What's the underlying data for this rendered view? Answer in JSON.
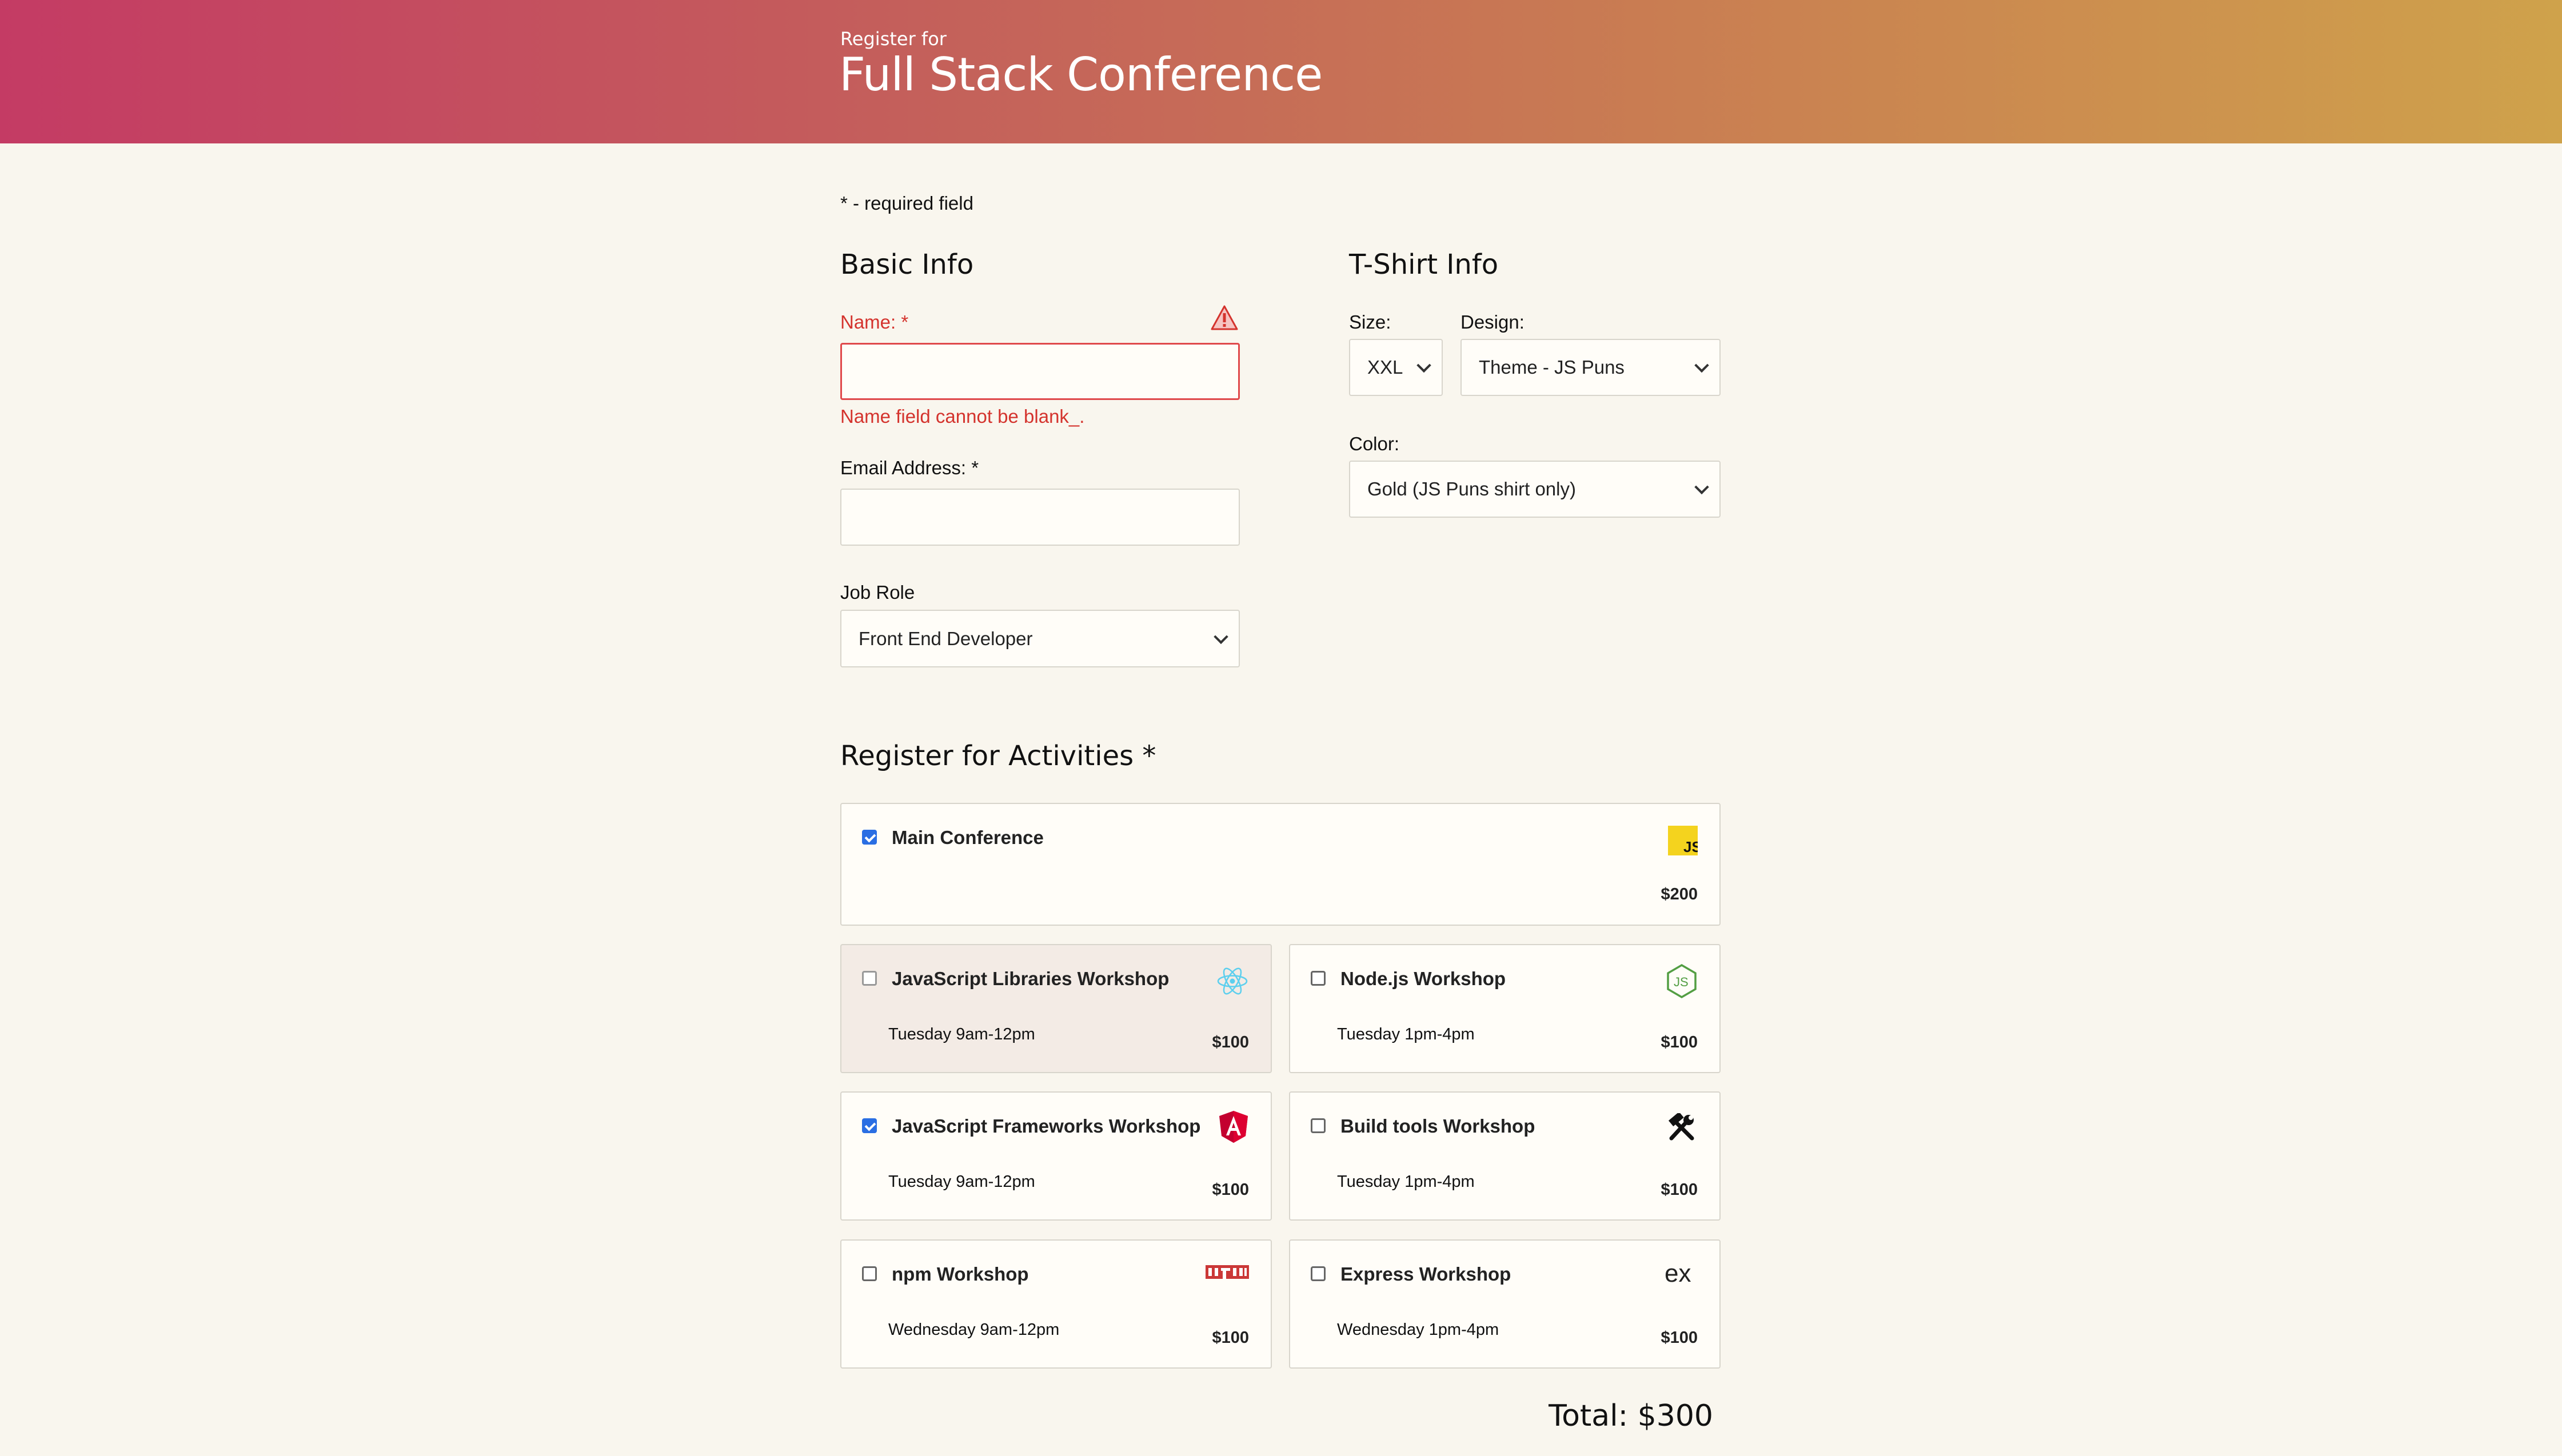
{
  "header": {
    "pre_title": "Register for",
    "title": "Full Stack Conference"
  },
  "required_note": "* - required field",
  "basic_info": {
    "title": "Basic Info",
    "name_label": "Name: *",
    "name_value": "",
    "name_error": "Name field cannot be blank_.",
    "email_label": "Email Address: *",
    "email_value": "",
    "job_role_label": "Job Role",
    "job_role_value": "Front End Developer"
  },
  "tshirt": {
    "title": "T-Shirt Info",
    "size_label": "Size:",
    "size_value": "XXL",
    "design_label": "Design:",
    "design_value": "Theme - JS Puns",
    "color_label": "Color:",
    "color_value": "Gold (JS Puns shirt only)"
  },
  "activities": {
    "title": "Register for Activities *",
    "items": [
      {
        "name": "Main Conference",
        "time": "",
        "price": "$200",
        "checked": true,
        "icon": "js-icon"
      },
      {
        "name": "JavaScript Libraries Workshop",
        "time": "Tuesday 9am-12pm",
        "price": "$100",
        "checked": false,
        "icon": "react-icon"
      },
      {
        "name": "Node.js Workshop",
        "time": "Tuesday 1pm-4pm",
        "price": "$100",
        "checked": false,
        "icon": "nodejs-icon"
      },
      {
        "name": "JavaScript Frameworks Workshop",
        "time": "Tuesday 9am-12pm",
        "price": "$100",
        "checked": true,
        "icon": "angular-icon"
      },
      {
        "name": "Build tools Workshop",
        "time": "Tuesday 1pm-4pm",
        "price": "$100",
        "checked": false,
        "icon": "tools-icon"
      },
      {
        "name": "npm Workshop",
        "time": "Wednesday 9am-12pm",
        "price": "$100",
        "checked": false,
        "icon": "npm-icon"
      },
      {
        "name": "Express Workshop",
        "time": "Wednesday 1pm-4pm",
        "price": "$100",
        "checked": false,
        "icon": "express-icon"
      }
    ],
    "total": "Total: $300"
  },
  "colors": {
    "error": "#d4332d",
    "checkbox": "#2a6ee3",
    "header_start": "#c43b64",
    "header_end": "#cfa24b"
  }
}
